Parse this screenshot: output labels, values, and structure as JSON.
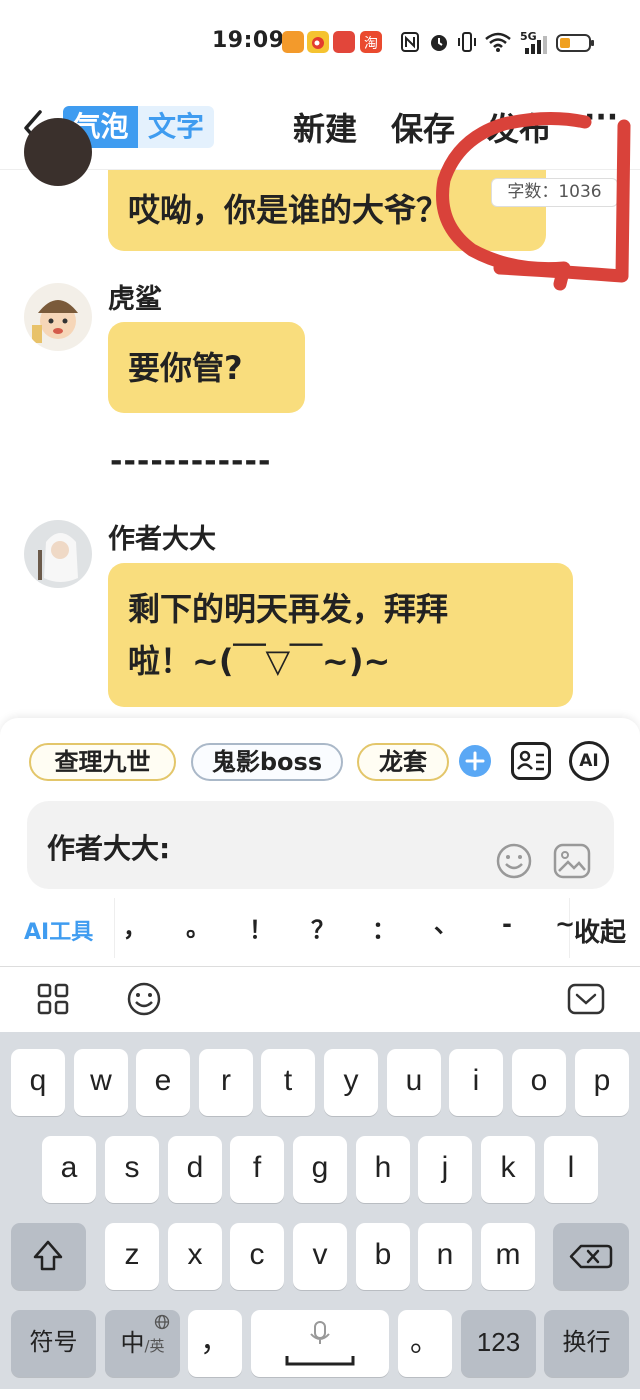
{
  "status_bar": {
    "time": "19:09",
    "network": "5G"
  },
  "header": {
    "mode_bubble": "气泡",
    "mode_text": "文字",
    "new_label": "新建",
    "save_label": "保存",
    "publish_label": "发布",
    "more_label": "···"
  },
  "word_count": "字数：1036",
  "messages": [
    {
      "text": "哎呦，你是谁的大爷？"
    },
    {
      "name": "虎鲨",
      "text": "要你管?"
    },
    {
      "divider": "------------"
    },
    {
      "name": "作者大大",
      "line1": "剩下的明天再发，拜拜",
      "line2": "啦！~(￣▽￣~)~"
    }
  ],
  "characters": [
    "查理九世",
    "鬼影boss",
    "龙套"
  ],
  "ai_button": "AI",
  "input": {
    "speaker_label": "作者大大:"
  },
  "ai_tool_label": "AI工具",
  "punctuation": [
    "，",
    "。",
    "！",
    "？",
    "：",
    "、",
    "-",
    "~"
  ],
  "collapse_label": "收起",
  "keyboard": {
    "row1": [
      "q",
      "w",
      "e",
      "r",
      "t",
      "y",
      "u",
      "i",
      "o",
      "p"
    ],
    "row2": [
      "a",
      "s",
      "d",
      "f",
      "g",
      "h",
      "j",
      "k",
      "l"
    ],
    "row3": [
      "z",
      "x",
      "c",
      "v",
      "b",
      "n",
      "m"
    ],
    "symbols_label": "符号",
    "lang_main": "中",
    "lang_alt": "/英",
    "comma": "，",
    "period": "。",
    "numbers_label": "123",
    "newline_label": "换行"
  },
  "colors": {
    "accent": "#3f9cf0",
    "bubble": "#f9dd7d",
    "annotation": "#d9423a"
  }
}
